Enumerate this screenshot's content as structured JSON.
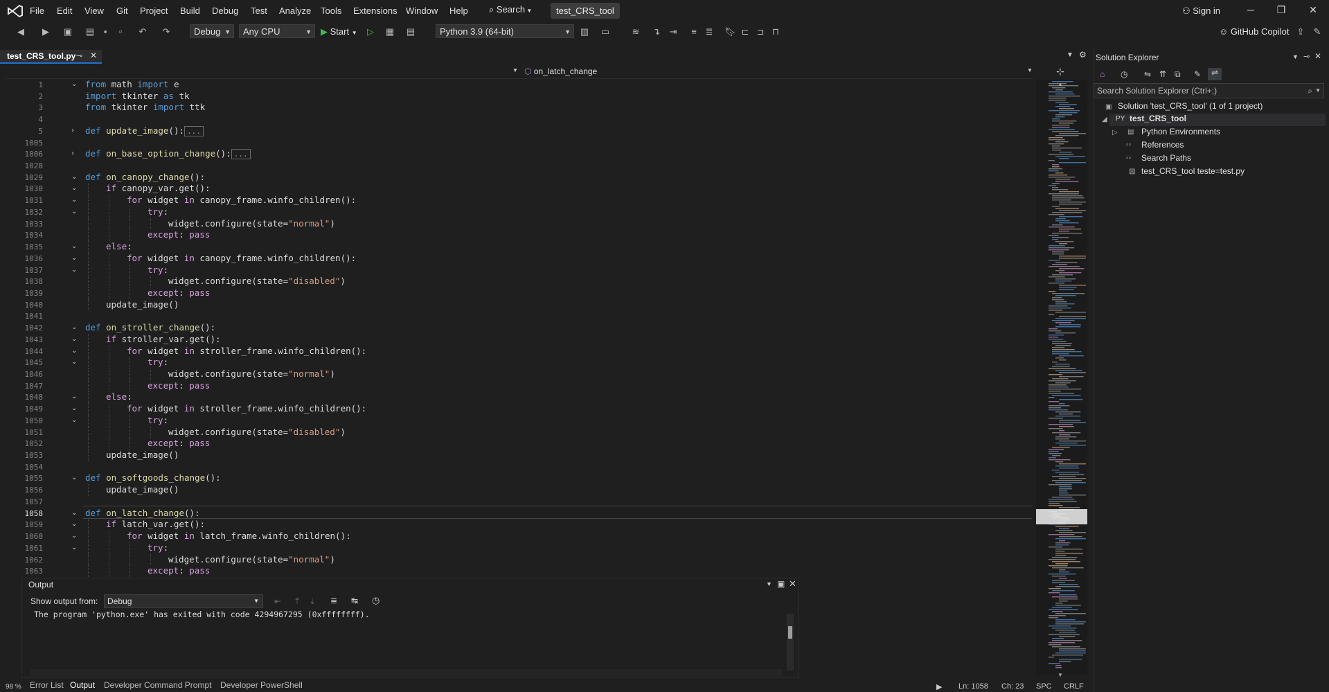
{
  "menu": {
    "items": [
      "File",
      "Edit",
      "View",
      "Git",
      "Project",
      "Build",
      "Debug",
      "Test",
      "Analyze",
      "Tools",
      "Extensions",
      "Window",
      "Help"
    ],
    "search_label": "Search",
    "solution_name": "test_CRS_tool",
    "sign_in": "Sign in"
  },
  "toolbar": {
    "configuration": "Debug",
    "platform": "Any CPU",
    "start_label": "Start",
    "python_env": "Python 3.9 (64-bit)",
    "copilot": "GitHub Copilot"
  },
  "editor": {
    "tab_title": "test_CRS_tool.py",
    "nav_function": "on_latch_change",
    "zoom": "98 %",
    "lines": [
      {
        "n": "1",
        "indent": 0,
        "fold": "open",
        "tokens": [
          [
            "kw",
            "from"
          ],
          [
            "id",
            " math "
          ],
          [
            "kw",
            "import"
          ],
          [
            "id",
            " e"
          ]
        ]
      },
      {
        "n": "2",
        "indent": 0,
        "fold": "",
        "tokens": [
          [
            "kw",
            "import"
          ],
          [
            "id",
            " tkinter "
          ],
          [
            "kw",
            "as"
          ],
          [
            "id",
            " tk"
          ]
        ]
      },
      {
        "n": "3",
        "indent": 0,
        "fold": "",
        "tokens": [
          [
            "kw",
            "from"
          ],
          [
            "id",
            " tkinter "
          ],
          [
            "kw",
            "import"
          ],
          [
            "id",
            " ttk"
          ]
        ]
      },
      {
        "n": "4",
        "indent": 0,
        "fold": "",
        "tokens": []
      },
      {
        "n": "5",
        "indent": 0,
        "fold": "closed",
        "tokens": [
          [
            "kw",
            "def"
          ],
          [
            "fn",
            " update_image"
          ],
          [
            "id",
            "():"
          ],
          [
            "box",
            "..."
          ]
        ]
      },
      {
        "n": "1005",
        "indent": 0,
        "fold": "",
        "tokens": []
      },
      {
        "n": "1006",
        "indent": 0,
        "fold": "closed",
        "tokens": [
          [
            "kw",
            "def"
          ],
          [
            "fn",
            " on_base_option_change"
          ],
          [
            "id",
            "():"
          ],
          [
            "box",
            "..."
          ]
        ]
      },
      {
        "n": "1028",
        "indent": 0,
        "fold": "",
        "tokens": []
      },
      {
        "n": "1029",
        "indent": 0,
        "fold": "open",
        "tokens": [
          [
            "kw",
            "def"
          ],
          [
            "fn",
            " on_canopy_change"
          ],
          [
            "id",
            "():"
          ]
        ]
      },
      {
        "n": "1030",
        "indent": 1,
        "fold": "open",
        "tokens": [
          [
            "ctl",
            "if"
          ],
          [
            "id",
            " canopy_var.get():"
          ]
        ]
      },
      {
        "n": "1031",
        "indent": 2,
        "fold": "open",
        "tokens": [
          [
            "ctl",
            "for"
          ],
          [
            "id",
            " widget "
          ],
          [
            "ctl",
            "in"
          ],
          [
            "id",
            " canopy_frame.winfo_children():"
          ]
        ]
      },
      {
        "n": "1032",
        "indent": 3,
        "fold": "open",
        "tokens": [
          [
            "ctl",
            "try"
          ],
          [
            "id",
            ":"
          ]
        ]
      },
      {
        "n": "1033",
        "indent": 4,
        "fold": "",
        "tokens": [
          [
            "id",
            "widget.configure(state="
          ],
          [
            "str",
            "\"normal\""
          ],
          [
            "id",
            ")"
          ]
        ]
      },
      {
        "n": "1034",
        "indent": 3,
        "fold": "",
        "tokens": [
          [
            "ctl",
            "except"
          ],
          [
            "id",
            ": "
          ],
          [
            "ctl",
            "pass"
          ]
        ]
      },
      {
        "n": "1035",
        "indent": 1,
        "fold": "open",
        "tokens": [
          [
            "ctl",
            "else"
          ],
          [
            "id",
            ":"
          ]
        ]
      },
      {
        "n": "1036",
        "indent": 2,
        "fold": "open",
        "tokens": [
          [
            "ctl",
            "for"
          ],
          [
            "id",
            " widget "
          ],
          [
            "ctl",
            "in"
          ],
          [
            "id",
            " canopy_frame.winfo_children():"
          ]
        ]
      },
      {
        "n": "1037",
        "indent": 3,
        "fold": "open",
        "tokens": [
          [
            "ctl",
            "try"
          ],
          [
            "id",
            ":"
          ]
        ]
      },
      {
        "n": "1038",
        "indent": 4,
        "fold": "",
        "tokens": [
          [
            "id",
            "widget.configure(state="
          ],
          [
            "str",
            "\"disabled\""
          ],
          [
            "id",
            ")"
          ]
        ]
      },
      {
        "n": "1039",
        "indent": 3,
        "fold": "",
        "tokens": [
          [
            "ctl",
            "except"
          ],
          [
            "id",
            ": "
          ],
          [
            "ctl",
            "pass"
          ]
        ]
      },
      {
        "n": "1040",
        "indent": 1,
        "fold": "",
        "tokens": [
          [
            "id",
            "update_image()"
          ]
        ]
      },
      {
        "n": "1041",
        "indent": 0,
        "fold": "",
        "tokens": []
      },
      {
        "n": "1042",
        "indent": 0,
        "fold": "open",
        "tokens": [
          [
            "kw",
            "def"
          ],
          [
            "fn",
            " on_stroller_change"
          ],
          [
            "id",
            "():"
          ]
        ]
      },
      {
        "n": "1043",
        "indent": 1,
        "fold": "open",
        "tokens": [
          [
            "ctl",
            "if"
          ],
          [
            "id",
            " stroller_var.get():"
          ]
        ]
      },
      {
        "n": "1044",
        "indent": 2,
        "fold": "open",
        "tokens": [
          [
            "ctl",
            "for"
          ],
          [
            "id",
            " widget "
          ],
          [
            "ctl",
            "in"
          ],
          [
            "id",
            " stroller_frame.winfo_children():"
          ]
        ]
      },
      {
        "n": "1045",
        "indent": 3,
        "fold": "open",
        "tokens": [
          [
            "ctl",
            "try"
          ],
          [
            "id",
            ":"
          ]
        ]
      },
      {
        "n": "1046",
        "indent": 4,
        "fold": "",
        "tokens": [
          [
            "id",
            "widget.configure(state="
          ],
          [
            "str",
            "\"normal\""
          ],
          [
            "id",
            ")"
          ]
        ]
      },
      {
        "n": "1047",
        "indent": 3,
        "fold": "",
        "tokens": [
          [
            "ctl",
            "except"
          ],
          [
            "id",
            ": "
          ],
          [
            "ctl",
            "pass"
          ]
        ]
      },
      {
        "n": "1048",
        "indent": 1,
        "fold": "open",
        "tokens": [
          [
            "ctl",
            "else"
          ],
          [
            "id",
            ":"
          ]
        ]
      },
      {
        "n": "1049",
        "indent": 2,
        "fold": "open",
        "tokens": [
          [
            "ctl",
            "for"
          ],
          [
            "id",
            " widget "
          ],
          [
            "ctl",
            "in"
          ],
          [
            "id",
            " stroller_frame.winfo_children():"
          ]
        ]
      },
      {
        "n": "1050",
        "indent": 3,
        "fold": "open",
        "tokens": [
          [
            "ctl",
            "try"
          ],
          [
            "id",
            ":"
          ]
        ]
      },
      {
        "n": "1051",
        "indent": 4,
        "fold": "",
        "tokens": [
          [
            "id",
            "widget.configure(state="
          ],
          [
            "str",
            "\"disabled\""
          ],
          [
            "id",
            ")"
          ]
        ]
      },
      {
        "n": "1052",
        "indent": 3,
        "fold": "",
        "tokens": [
          [
            "ctl",
            "except"
          ],
          [
            "id",
            ": "
          ],
          [
            "ctl",
            "pass"
          ]
        ]
      },
      {
        "n": "1053",
        "indent": 1,
        "fold": "",
        "tokens": [
          [
            "id",
            "update_image()"
          ]
        ]
      },
      {
        "n": "1054",
        "indent": 0,
        "fold": "",
        "tokens": []
      },
      {
        "n": "1055",
        "indent": 0,
        "fold": "open",
        "tokens": [
          [
            "kw",
            "def"
          ],
          [
            "fn",
            " on_softgoods_change"
          ],
          [
            "id",
            "():"
          ]
        ]
      },
      {
        "n": "1056",
        "indent": 1,
        "fold": "",
        "tokens": [
          [
            "id",
            "update_image()"
          ]
        ]
      },
      {
        "n": "1057",
        "indent": 0,
        "fold": "",
        "tokens": []
      },
      {
        "n": "1058",
        "indent": 0,
        "fold": "open",
        "tokens": [
          [
            "kw",
            "def"
          ],
          [
            "fn",
            " on_latch_change"
          ],
          [
            "id",
            "():"
          ]
        ]
      },
      {
        "n": "1059",
        "indent": 1,
        "fold": "open",
        "tokens": [
          [
            "ctl",
            "if"
          ],
          [
            "id",
            " latch_var.get():"
          ]
        ]
      },
      {
        "n": "1060",
        "indent": 2,
        "fold": "open",
        "tokens": [
          [
            "ctl",
            "for"
          ],
          [
            "id",
            " widget "
          ],
          [
            "ctl",
            "in"
          ],
          [
            "id",
            " latch_frame.winfo_children():"
          ]
        ]
      },
      {
        "n": "1061",
        "indent": 3,
        "fold": "open",
        "tokens": [
          [
            "ctl",
            "try"
          ],
          [
            "id",
            ":"
          ]
        ]
      },
      {
        "n": "1062",
        "indent": 4,
        "fold": "",
        "tokens": [
          [
            "id",
            "widget.configure(state="
          ],
          [
            "str",
            "\"normal\""
          ],
          [
            "id",
            ")"
          ]
        ]
      },
      {
        "n": "1063",
        "indent": 3,
        "fold": "",
        "tokens": [
          [
            "ctl",
            "except"
          ],
          [
            "id",
            ": "
          ],
          [
            "ctl",
            "pass"
          ]
        ]
      }
    ]
  },
  "output": {
    "title": "Output",
    "show_from_label": "Show output from:",
    "source": "Debug",
    "text": "The program 'python.exe' has exited with code 4294967295 (0xffffffff)."
  },
  "bottom_tabs": [
    "Error List",
    "Output",
    "Developer Command Prompt",
    "Developer PowerShell"
  ],
  "status": {
    "ln": "Ln: 1058",
    "ch": "Ch: 23",
    "spc": "SPC",
    "crlf": "CRLF"
  },
  "solution_explorer": {
    "title": "Solution Explorer",
    "search_placeholder": "Search Solution Explorer (Ctrl+;)",
    "solution": "Solution 'test_CRS_tool' (1 of 1 project)",
    "project": "test_CRS_tool",
    "items": [
      "Python Environments",
      "References",
      "Search Paths",
      "test_CRS_tool teste=test.py"
    ]
  }
}
